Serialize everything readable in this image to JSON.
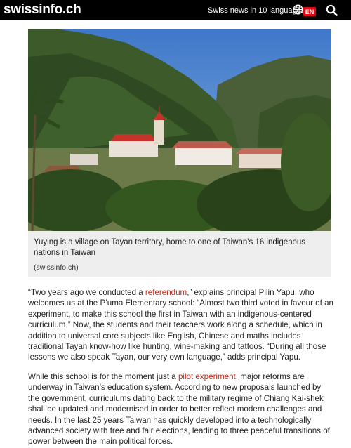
{
  "header": {
    "logo": "swissinfo.ch",
    "tagline": "Swiss news in 10 languages",
    "language": "EN",
    "icons": {
      "globe": "globe-icon",
      "search": "search-icon"
    },
    "colors": {
      "bar": "#000000",
      "lang_badge": "#e20613",
      "link": "#c0271a"
    }
  },
  "figure": {
    "caption": "Yuying is a village on Tayan territory, home to one of Taiwan's 16 indigenous nations in Taiwan",
    "credit": "(swissinfo.ch)"
  },
  "article": {
    "p1": {
      "before_link": "“Two years ago we conducted a ",
      "link": "referendum",
      "after_link": ",” explains principal Pilin Yapu, who welcomes us at the P’uma Elementary school: “Almost two third voted in favour of an experiment, to make this school the first in Taiwan with an indigenous-centered curriculum.” Now, the students and their teachers work along a schedule, which in addition to universal core subjects like English, Chinese and maths includes traditional Tayan know-how like hunting, wine-making and tattoos. “During all those lessons we also speak Tayan, our very own language,” adds principal Yapu."
    },
    "p2": {
      "before_link": "While this school is for the moment just a ",
      "link": "pilot experiment",
      "after_link": ", major reforms are underway in Taiwan’s education system. According to new proposals launched by the government, curriculums dating back to the military regime of Chiang Kai-shek shall be updated and modernised in order to better reflect modern challenges and needs. In the last 25 years Taiwan has quickly developed into a technologically advanced society with free and fair elections, leading to three peaceful transitions of power between the main political forces."
    }
  }
}
